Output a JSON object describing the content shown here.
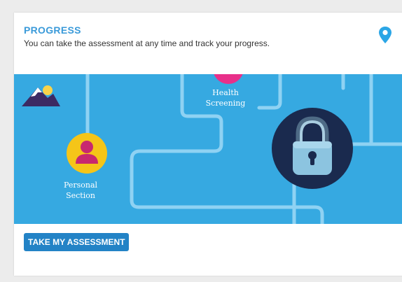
{
  "card": {
    "title": "PROGRESS",
    "subtitle": "You can take the assessment at any time and track your progress.",
    "location_icon": "map-pin-icon"
  },
  "banner": {
    "background_color": "#36a9e1",
    "nodes": [
      {
        "label_line1": "Health",
        "label_line2": "Screening",
        "icon": "health-node"
      },
      {
        "label_line1": "Personal",
        "label_line2": "Section",
        "icon": "person-icon"
      },
      {
        "icon": "lock-icon"
      }
    ],
    "logo_icon": "mountain-sun-icon"
  },
  "cta": {
    "label": "TAKE MY ASSESSMENT"
  },
  "colors": {
    "accent": "#3a9ad9",
    "button": "#2383c6",
    "lock_circle": "#1a2a4e",
    "personal_circle": "#f5c518",
    "health_circle": "#e8308a"
  }
}
